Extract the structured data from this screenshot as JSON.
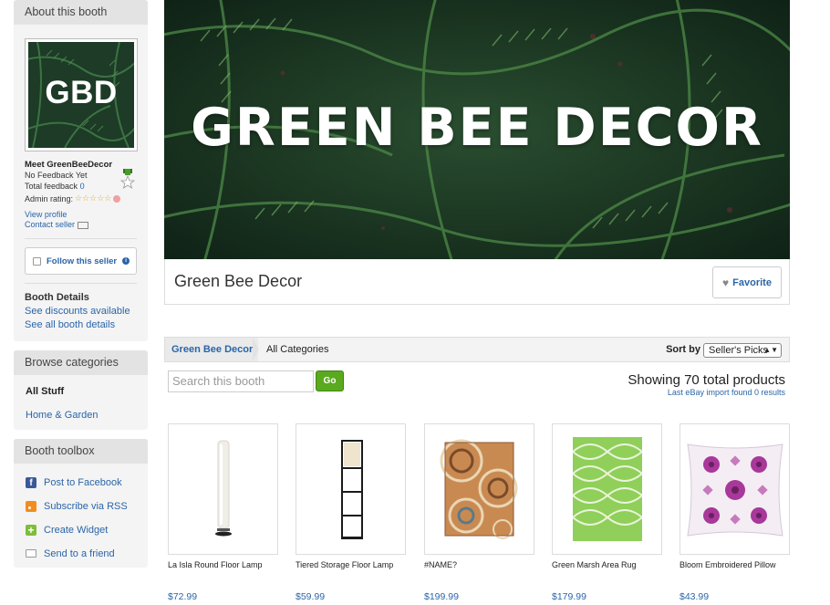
{
  "sidebar": {
    "about": {
      "heading": "About this booth",
      "logo_text": "GBD",
      "meet": "Meet GreenBeeDecor",
      "feedback_status": "No Feedback Yet",
      "total_feedback_label": "Total feedback",
      "total_feedback_count": "0",
      "admin_rating_label": "Admin rating:",
      "admin_rating_stars": "☆☆☆☆☆",
      "view_profile": "View profile",
      "contact_seller": "Contact seller",
      "follow_label": "Follow this seller",
      "booth_details_heading": "Booth Details",
      "see_discounts": "See discounts available",
      "see_all_details": "See all booth details"
    },
    "categories": {
      "heading": "Browse categories",
      "all_stuff": "All Stuff",
      "items": [
        "Home & Garden"
      ]
    },
    "toolbox": {
      "heading": "Booth toolbox",
      "items": [
        {
          "label": "Post to Facebook",
          "icon": "facebook-icon"
        },
        {
          "label": "Subscribe via RSS",
          "icon": "rss-icon"
        },
        {
          "label": "Create Widget",
          "icon": "plus-icon"
        },
        {
          "label": "Send to a friend",
          "icon": "mail-icon"
        }
      ]
    }
  },
  "banner": {
    "text": "GREEN BEE DECOR"
  },
  "booth": {
    "title": "Green Bee Decor",
    "favorite_label": "Favorite"
  },
  "breadcrumb": {
    "booth": "Green Bee Decor",
    "current": "All Categories"
  },
  "sort": {
    "label": "Sort by",
    "selected": "Seller's Picks"
  },
  "search": {
    "placeholder": "Search this booth",
    "button": "Go"
  },
  "summary": {
    "showing": "Showing 70 total products",
    "import_note": "Last eBay import found 0 results"
  },
  "products": [
    {
      "name": "La Isla Round Floor Lamp",
      "price": "$72.99"
    },
    {
      "name": "Tiered Storage Floor Lamp",
      "price": "$59.99"
    },
    {
      "name": "#NAME?",
      "price": "$199.99"
    },
    {
      "name": "Green Marsh Area Rug",
      "price": "$179.99"
    },
    {
      "name": "Bloom Embroidered Pillow",
      "price": "$43.99"
    }
  ],
  "colors": {
    "link": "#2a65a8",
    "go_button": "#5aa91f",
    "panel_bg": "#f4f4f4",
    "panel_head": "#e3e3e3",
    "fern_dark": "#16301f"
  }
}
